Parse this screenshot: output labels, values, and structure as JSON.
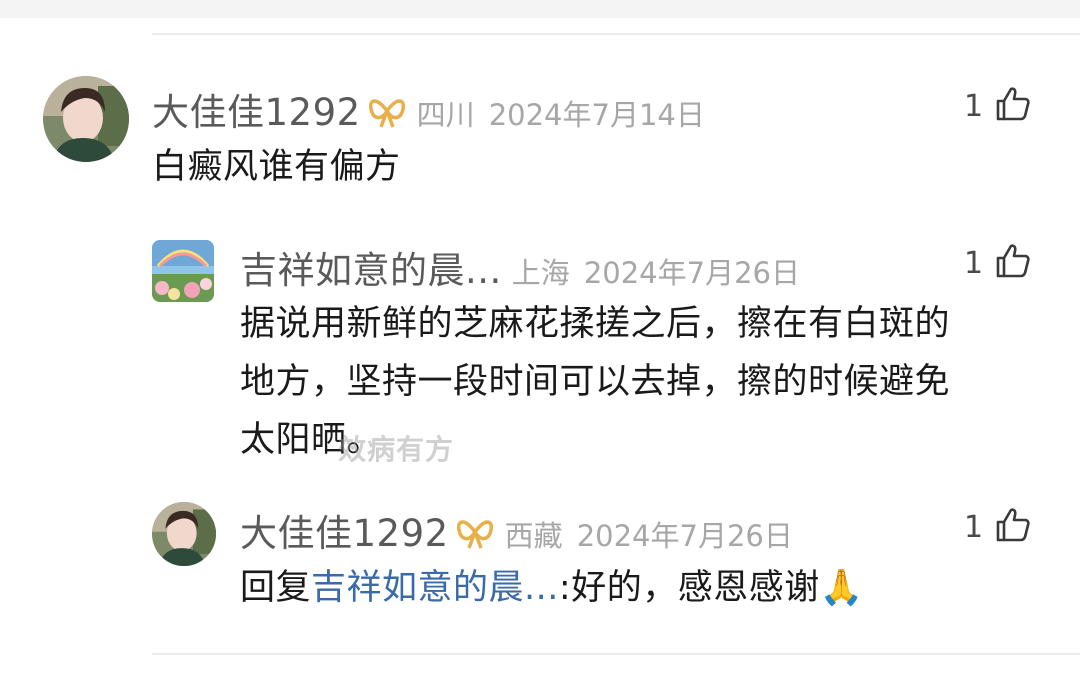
{
  "comments": [
    {
      "username": "大佳佳1292",
      "location": "四川",
      "date": "2024年7月14日",
      "likes": "1",
      "text": "白癜风谁有偏方"
    },
    {
      "username": "吉祥如意的晨...",
      "location": "上海",
      "date": "2024年7月26日",
      "likes": "1",
      "text_lines": [
        "据说用新鲜的芝麻花揉搓之后，擦在有白斑的",
        "地方，坚持一段时间可以去掉，擦的时候避免",
        "太阳晒。"
      ]
    },
    {
      "username": "大佳佳1292",
      "location": "西藏",
      "date": "2024年7月26日",
      "likes": "1",
      "reply_prefix": "回复",
      "reply_to": "吉祥如意的晨...",
      "reply_text": ":好的，感恩感谢🙏"
    }
  ],
  "watermark": "效病有方",
  "colors": {
    "username": "#5a5a5a",
    "meta": "#a7a7a7",
    "link": "#3a6aa8",
    "badge": "#e8b04a"
  },
  "icons": {
    "badge": "gold-ribbon-badge-icon",
    "like": "thumbs-up-icon"
  }
}
